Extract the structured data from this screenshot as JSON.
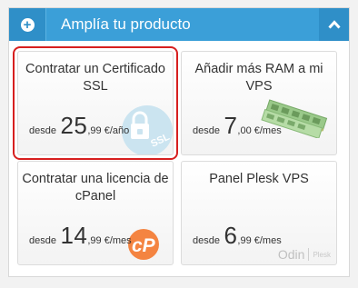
{
  "header": {
    "title": "Amplía tu producto"
  },
  "products": [
    {
      "title": "Contratar un Certificado SSL",
      "from": "desde",
      "price_int": "25",
      "price_dec": ",99 €/año"
    },
    {
      "title": "Añadir más RAM a mi VPS",
      "from": "desde",
      "price_int": "7",
      "price_dec": ",00 €/mes"
    },
    {
      "title": "Contratar una licencia de cPanel",
      "from": "desde",
      "price_int": "14",
      "price_dec": ",99 €/mes"
    },
    {
      "title": "Panel Plesk VPS",
      "from": "desde",
      "price_int": "6",
      "price_dec": ",99 €/mes"
    }
  ],
  "icons": {
    "header_expand": "plus-icon",
    "header_collapse": "chevron-up-icon",
    "ssl": "ssl-lock-icon",
    "ram": "ram-module-icon",
    "cpanel": "cpanel-logo",
    "plesk": "odin-plesk-logo"
  },
  "logos": {
    "ssl_badge": "SSL",
    "odin": "Odin",
    "plesk_sub": "Plesk"
  },
  "colors": {
    "header": "#3b9fd8",
    "header_dark": "#2f8fc8",
    "selection": "#d71f1f",
    "cpanel": "#f37021"
  }
}
